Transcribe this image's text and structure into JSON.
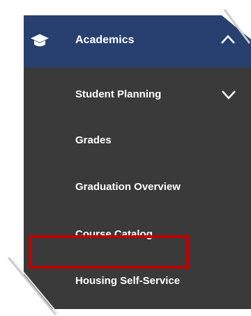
{
  "menu": {
    "header": {
      "label": "Academics",
      "icon": "graduation-cap-icon",
      "chevron": "chevron-up-icon"
    },
    "items": [
      {
        "label": "Student Planning",
        "has_chevron": true
      },
      {
        "label": "Grades"
      },
      {
        "label": "Graduation Overview"
      },
      {
        "label": "Course Catalog"
      },
      {
        "label": "Housing Self-Service",
        "highlighted": true
      }
    ]
  },
  "colors": {
    "header_bg": "#27406f",
    "menu_bg": "#3a3a3a",
    "highlight_border": "#c00000",
    "text": "#ffffff"
  }
}
